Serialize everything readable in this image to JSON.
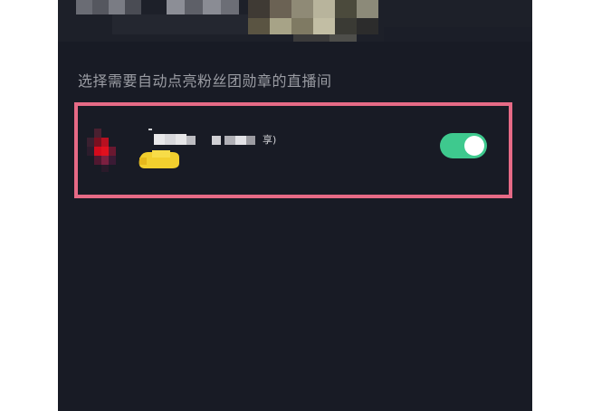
{
  "header": {
    "blurred_content": "pixelated header"
  },
  "section": {
    "title": "选择需要自动点亮粉丝团勋章的直播间"
  },
  "rooms": [
    {
      "avatar": "pixelated-avatar",
      "name_suffix": "享)",
      "toggle_on": true
    }
  ],
  "colors": {
    "background": "#181b25",
    "highlight": "#e66a86",
    "toggle_on": "#3ec98e",
    "title_text": "#9a9ca3"
  }
}
